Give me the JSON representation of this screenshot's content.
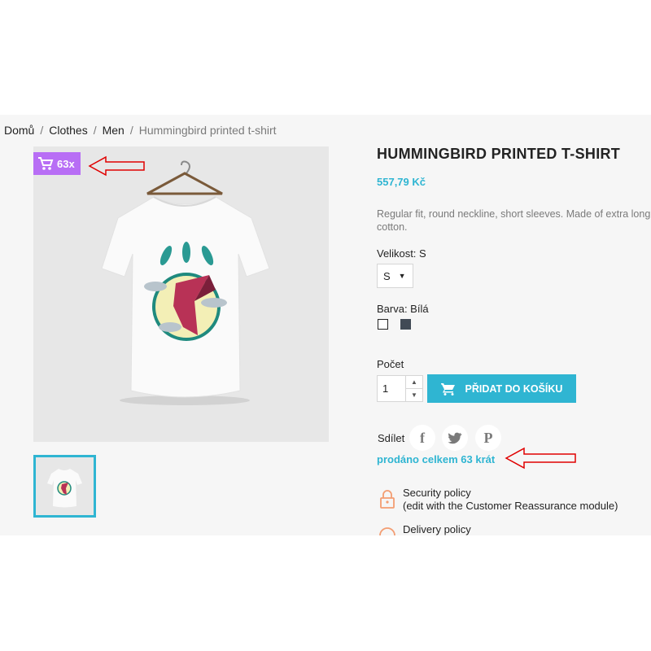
{
  "breadcrumb": [
    "Domů",
    "Clothes",
    "Men",
    "Hummingbird printed t-shirt"
  ],
  "badge": {
    "text": "63x",
    "icon": "cart-icon",
    "color": "#b86ef5"
  },
  "product": {
    "title": "HUMMINGBIRD PRINTED T-SHIRT",
    "price": "557,79 Kč",
    "description_line1": "Regular fit, round neckline, short sleeves. Made of extra long staple pima",
    "description_line2": "cotton."
  },
  "size": {
    "label": "Velikost: S",
    "selected": "S"
  },
  "color": {
    "label": "Barva: Bílá",
    "options": [
      "#ffffff",
      "#414a55"
    ]
  },
  "quantity": {
    "label": "Počet",
    "value": "1"
  },
  "add_to_cart": {
    "label": "PŘIDAT DO KOŠÍKU",
    "color": "#2fb5d2"
  },
  "share": {
    "label": "Sdílet",
    "networks": [
      "facebook",
      "twitter",
      "pinterest"
    ]
  },
  "sold_total": "prodáno celkem 63 krát",
  "reassurance": [
    {
      "title": "Security policy",
      "subtitle": "(edit with the Customer Reassurance module)",
      "icon": "security-icon"
    },
    {
      "title": "Delivery policy",
      "icon": "delivery-icon"
    }
  ],
  "annotation_color": "#e00000"
}
